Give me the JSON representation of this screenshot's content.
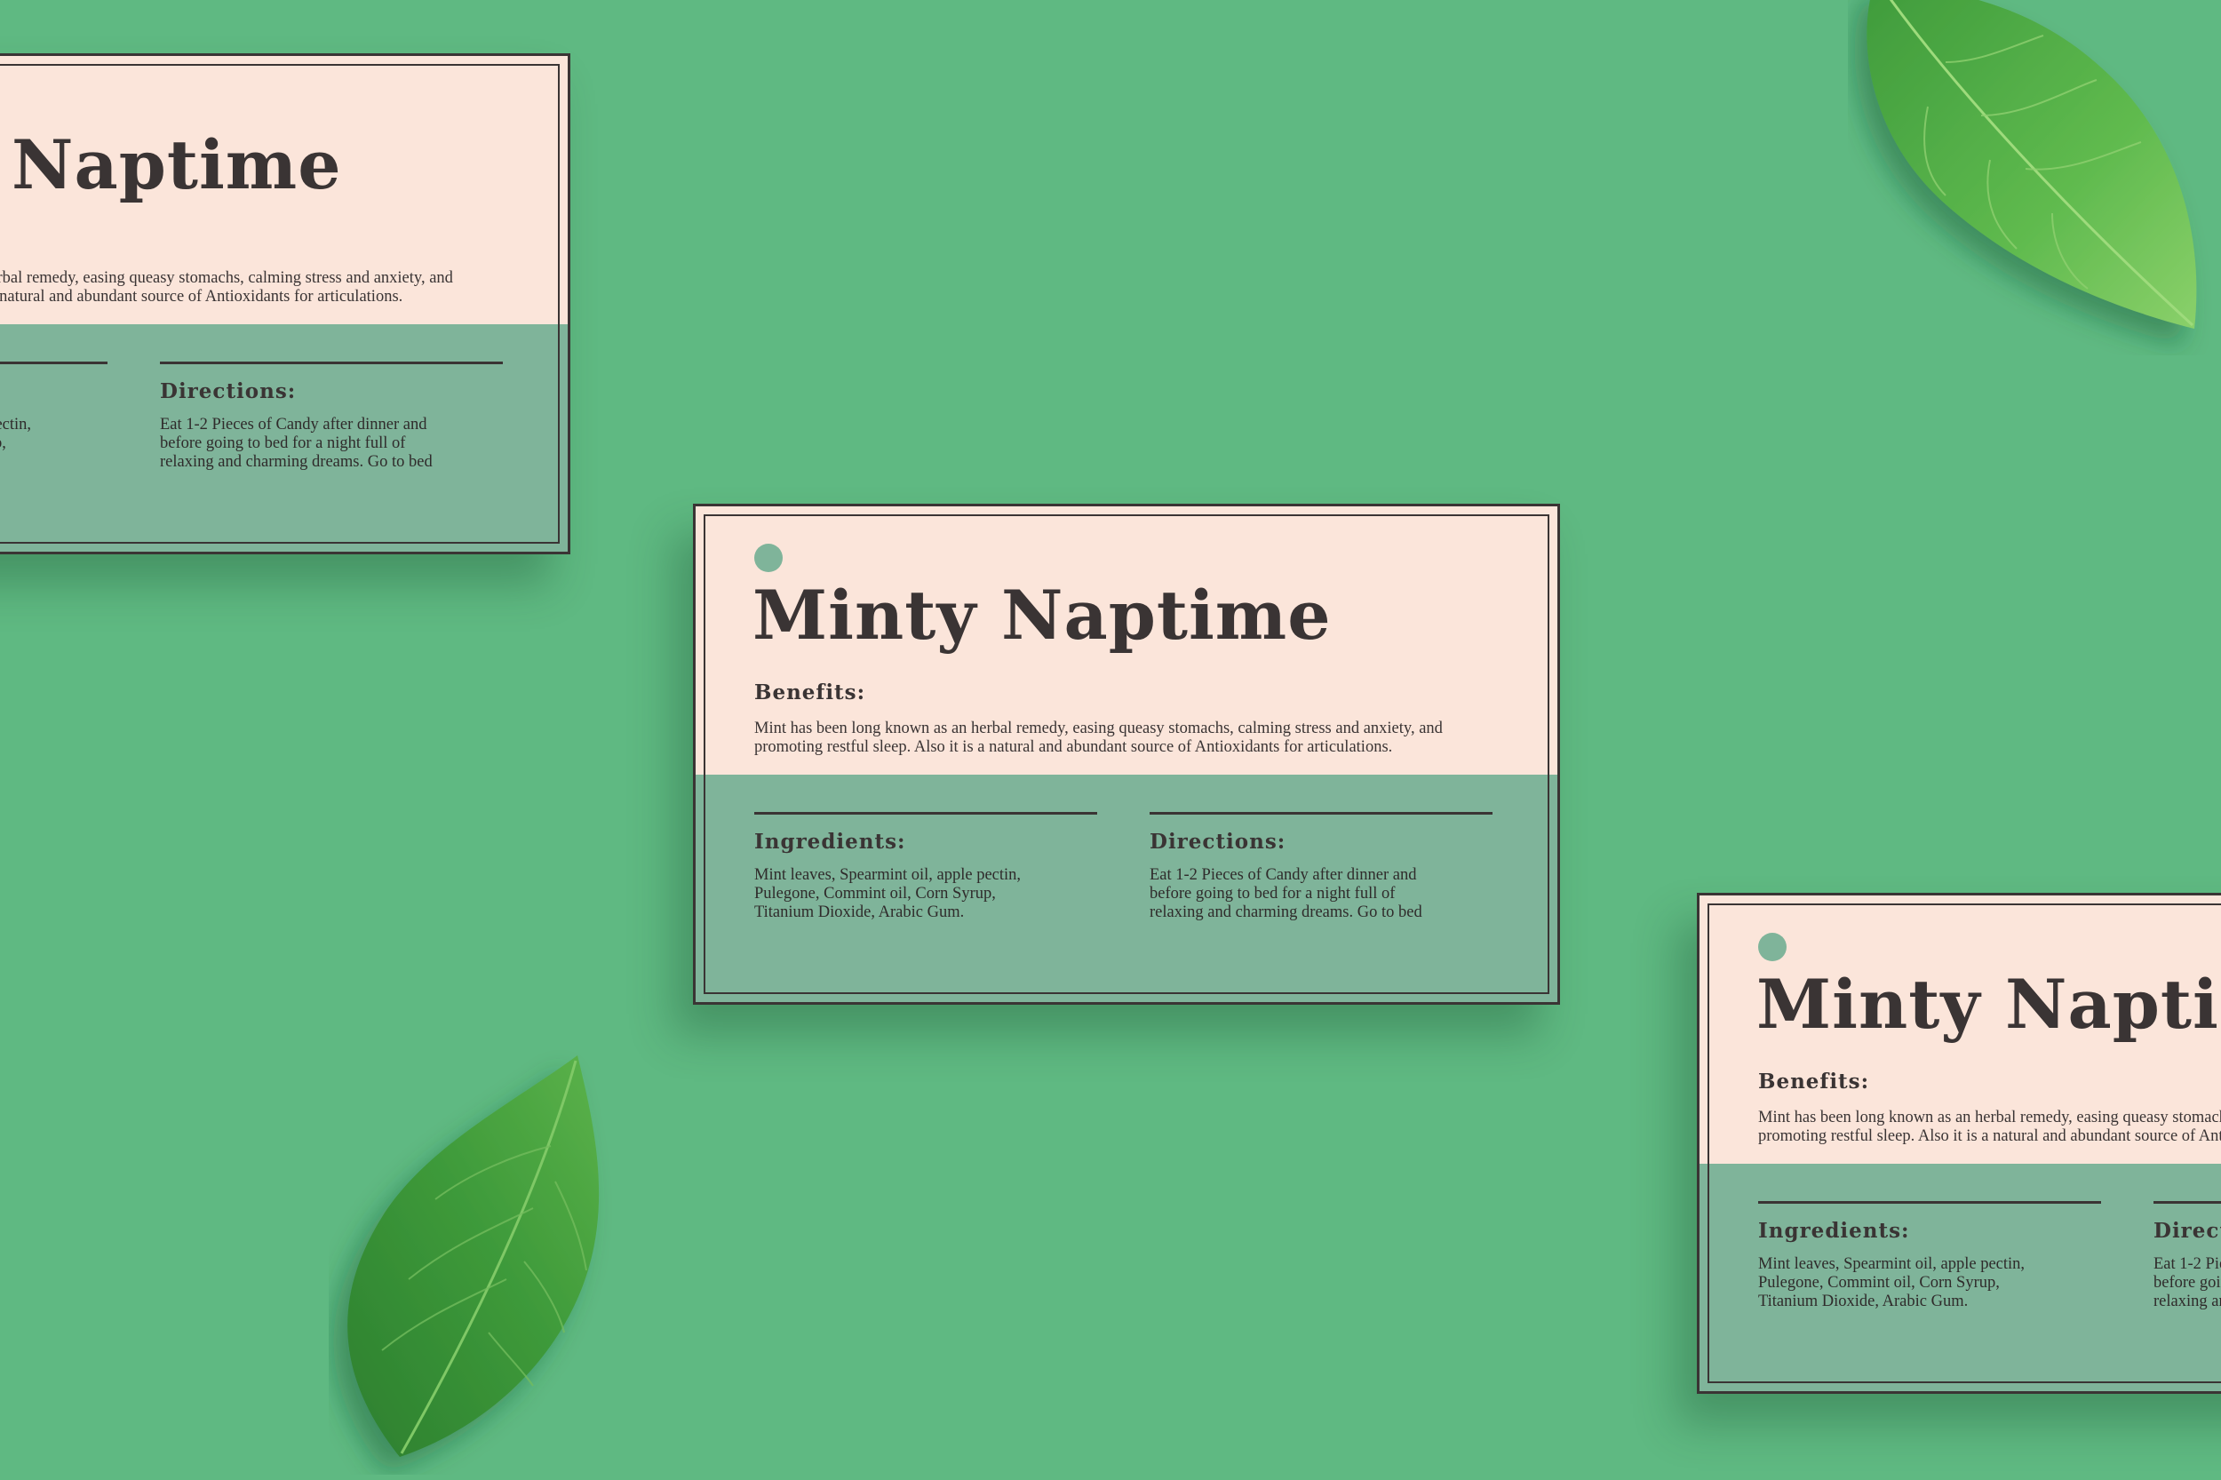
{
  "colors": {
    "background": "#5fb982",
    "card_cream": "#fbe5da",
    "card_green": "#7fb49a",
    "ink": "#3a3434",
    "leaf_dark": "#2f8f3c",
    "leaf_light": "#6cc062"
  },
  "card": {
    "title": "Minty Naptime",
    "benefits_heading": "Benefits:",
    "benefits_line1": "Mint has been long known as an herbal remedy, easing queasy stomachs, calming stress and anxiety, and",
    "benefits_line2": "promoting restful sleep. Also it is a natural and abundant source of Antioxidants for articulations.",
    "ingredients_heading": "Ingredients:",
    "ingredients_line1": "Mint leaves, Spearmint oil, apple pectin,",
    "ingredients_line2": "Pulegone, Commint oil, Corn Syrup,",
    "ingredients_line3": "Titanium Dioxide, Arabic Gum.",
    "directions_heading": "Directions:",
    "directions_line1": "Eat 1-2 Pieces of Candy after dinner and",
    "directions_line2": "before going to bed for a night full of",
    "directions_line3": "relaxing and charming dreams. Go to bed"
  },
  "decorations": {
    "icons": [
      "leaf-icon",
      "brand-dot-icon"
    ]
  }
}
